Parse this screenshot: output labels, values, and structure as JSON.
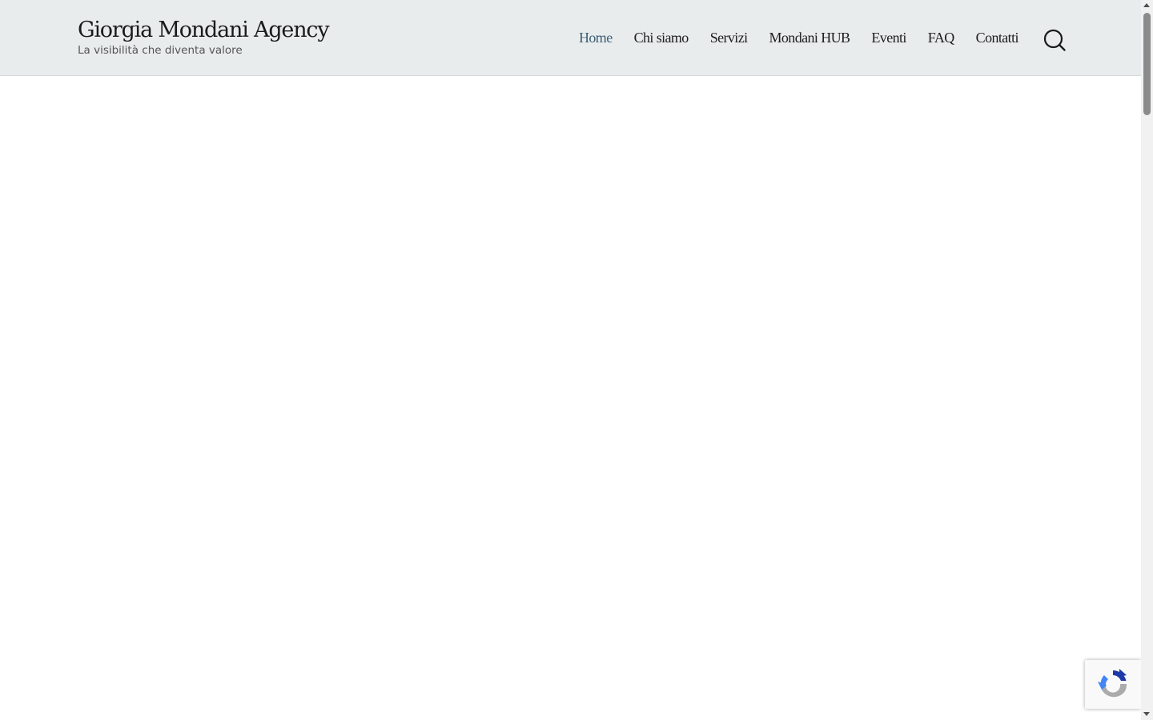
{
  "site": {
    "title": "Giorgia Mondani Agency",
    "tagline": "La visibilità che diventa valore"
  },
  "nav": {
    "items": [
      {
        "label": "Home",
        "active": true
      },
      {
        "label": "Chi siamo",
        "active": false
      },
      {
        "label": "Servizi",
        "active": false
      },
      {
        "label": "Mondani HUB",
        "active": false
      },
      {
        "label": "Eventi",
        "active": false
      },
      {
        "label": "FAQ",
        "active": false
      },
      {
        "label": "Contatti",
        "active": false
      }
    ]
  },
  "icons": {
    "search": "search-icon",
    "recaptcha": "recaptcha-icon"
  },
  "colors": {
    "header_bg": "#e9eced",
    "nav_active": "#3b5f77",
    "nav_text": "#1d1d1d"
  }
}
